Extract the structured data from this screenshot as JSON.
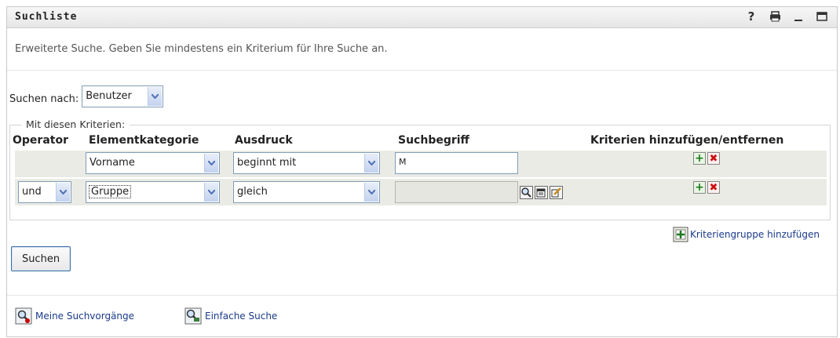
{
  "panel": {
    "title": "Suchliste",
    "icons": [
      "help-icon",
      "print-icon",
      "minimize-icon",
      "maximize-icon"
    ],
    "help_glyph": "?"
  },
  "intro": "Erweiterte Suche. Geben Sie mindestens ein Kriterium für Ihre Suche an.",
  "search_for": {
    "label": "Suchen nach:",
    "value": "Benutzer"
  },
  "criteria": {
    "legend": "Mit diesen Kriterien:",
    "headers": {
      "operator": "Operator",
      "category": "Elementkategorie",
      "expression": "Ausdruck",
      "term": "Suchbegriff",
      "addremove": "Kriterien hinzufügen/entfernen"
    },
    "rows": [
      {
        "operator": "",
        "category": "Vorname",
        "expression": "beginnt mit",
        "term": "M"
      },
      {
        "operator": "und",
        "category": "Gruppe",
        "expression": "gleich",
        "term": ""
      }
    ]
  },
  "add_group_label": "Kriteriengruppe hinzufügen",
  "search_button": "Suchen",
  "footer": {
    "my_searches": "Meine Suchvorgänge",
    "simple_search": "Einfache Suche"
  },
  "colors": {
    "accent": "#1a3a8a",
    "row_bg": "#ebebe6",
    "border": "#7f9db9"
  }
}
